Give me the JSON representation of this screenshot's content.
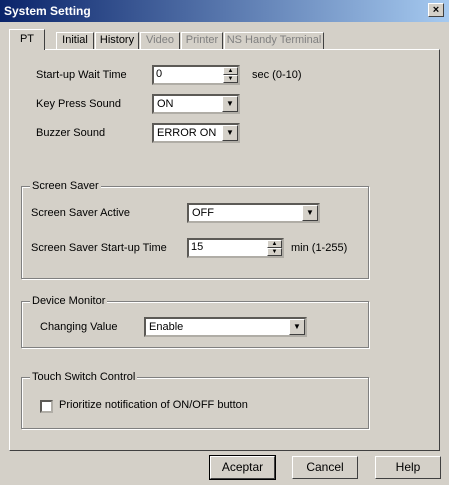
{
  "window": {
    "title": "System Setting",
    "close_glyph": "×"
  },
  "tabs": [
    {
      "label": "PT",
      "enabled": true,
      "active": true
    },
    {
      "label": "Initial",
      "enabled": true,
      "active": false
    },
    {
      "label": "History",
      "enabled": true,
      "active": false
    },
    {
      "label": "Video",
      "enabled": false,
      "active": false
    },
    {
      "label": "Printer",
      "enabled": false,
      "active": false
    },
    {
      "label": "NS Handy Terminal",
      "enabled": false,
      "active": false
    }
  ],
  "pt": {
    "startup_wait": {
      "label": "Start-up Wait Time",
      "value": "0",
      "hint": "sec (0-10)"
    },
    "key_press": {
      "label": "Key Press Sound",
      "value": "ON"
    },
    "buzzer": {
      "label": "Buzzer Sound",
      "value": "ERROR ON"
    }
  },
  "screen_saver": {
    "group_title": "Screen Saver",
    "active": {
      "label": "Screen Saver Active",
      "value": "OFF"
    },
    "startup_time": {
      "label": "Screen Saver Start-up Time",
      "value": "15",
      "hint": "min (1-255)"
    }
  },
  "device_monitor": {
    "group_title": "Device Monitor",
    "changing_value": {
      "label": "Changing Value",
      "value": "Enable"
    }
  },
  "touch_switch": {
    "group_title": "Touch Switch Control",
    "prioritize": {
      "label": "Prioritize notification of ON/OFF button",
      "checked": false
    }
  },
  "buttons": {
    "ok": "Aceptar",
    "cancel": "Cancel",
    "help": "Help"
  },
  "glyphs": {
    "up": "▲",
    "down": "▼",
    "dropdown": "▼"
  }
}
